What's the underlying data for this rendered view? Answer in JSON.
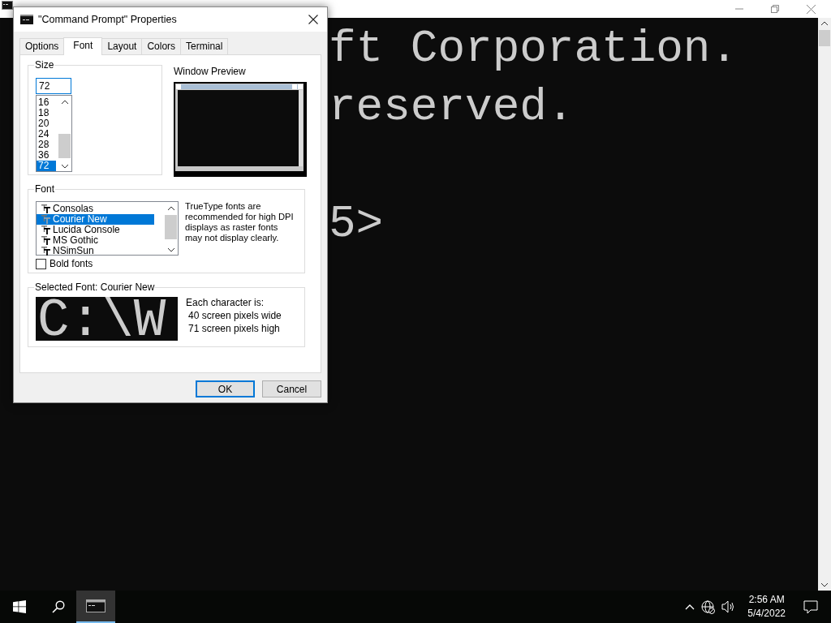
{
  "console": {
    "lines": [
      "ft Corporation.",
      "reserved.",
      "5>"
    ]
  },
  "dialog": {
    "title": "\"Command Prompt\" Properties",
    "tabs": [
      {
        "label": "Options",
        "selected": false
      },
      {
        "label": "Font",
        "selected": true
      },
      {
        "label": "Layout",
        "selected": false
      },
      {
        "label": "Colors",
        "selected": false
      },
      {
        "label": "Terminal",
        "selected": false
      }
    ],
    "size_group": {
      "label": "Size",
      "value": "72",
      "options": [
        {
          "label": "16",
          "selected": false
        },
        {
          "label": "18",
          "selected": false
        },
        {
          "label": "20",
          "selected": false
        },
        {
          "label": "24",
          "selected": false
        },
        {
          "label": "28",
          "selected": false
        },
        {
          "label": "36",
          "selected": false
        },
        {
          "label": "72",
          "selected": true
        }
      ]
    },
    "preview_label": "Window Preview",
    "font_group": {
      "label": "Font",
      "fonts": [
        {
          "name": "Consolas",
          "selected": false
        },
        {
          "name": "Courier New",
          "selected": true
        },
        {
          "name": "Lucida Console",
          "selected": false
        },
        {
          "name": "MS Gothic",
          "selected": false
        },
        {
          "name": "NSimSun",
          "selected": false
        }
      ],
      "note": "TrueType fonts are recommended for high DPI displays as raster fonts may not display clearly.",
      "bold_fonts": {
        "label": "Bold fonts",
        "checked": false
      }
    },
    "selected_font": {
      "label": "Selected Font: Courier New",
      "sample": "C:\\W",
      "info_title": "Each character is:",
      "width_line": "40 screen pixels wide",
      "height_line": "71 screen pixels high"
    },
    "buttons": [
      {
        "label": "OK",
        "default": true
      },
      {
        "label": "Cancel",
        "default": false
      }
    ]
  },
  "taskbar": {
    "time": "2:56 AM",
    "date": "5/4/2022"
  }
}
